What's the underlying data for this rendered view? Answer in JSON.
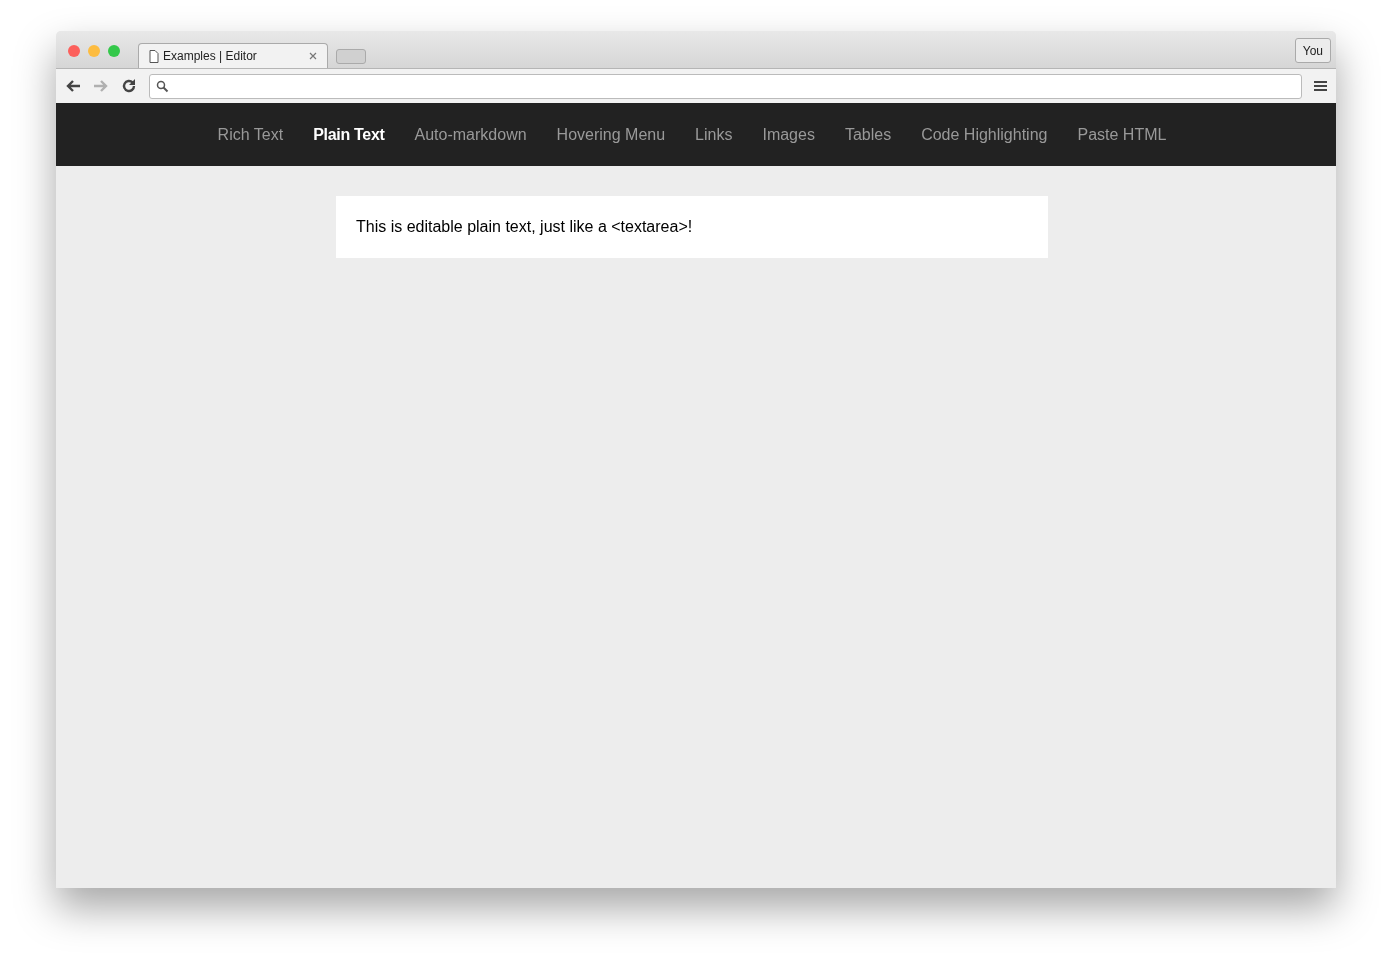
{
  "browser": {
    "tab": {
      "title": "Examples | Editor"
    },
    "profile_button": "You",
    "forward_disabled": true
  },
  "nav": {
    "items": [
      {
        "label": "Rich Text",
        "selected": false
      },
      {
        "label": "Plain Text",
        "selected": true
      },
      {
        "label": "Auto-markdown",
        "selected": false
      },
      {
        "label": "Hovering Menu",
        "selected": false
      },
      {
        "label": "Links",
        "selected": false
      },
      {
        "label": "Images",
        "selected": false
      },
      {
        "label": "Tables",
        "selected": false
      },
      {
        "label": "Code Highlighting",
        "selected": false
      },
      {
        "label": "Paste HTML",
        "selected": false
      }
    ]
  },
  "editor": {
    "text": "This is editable plain text, just like a <textarea>!"
  }
}
